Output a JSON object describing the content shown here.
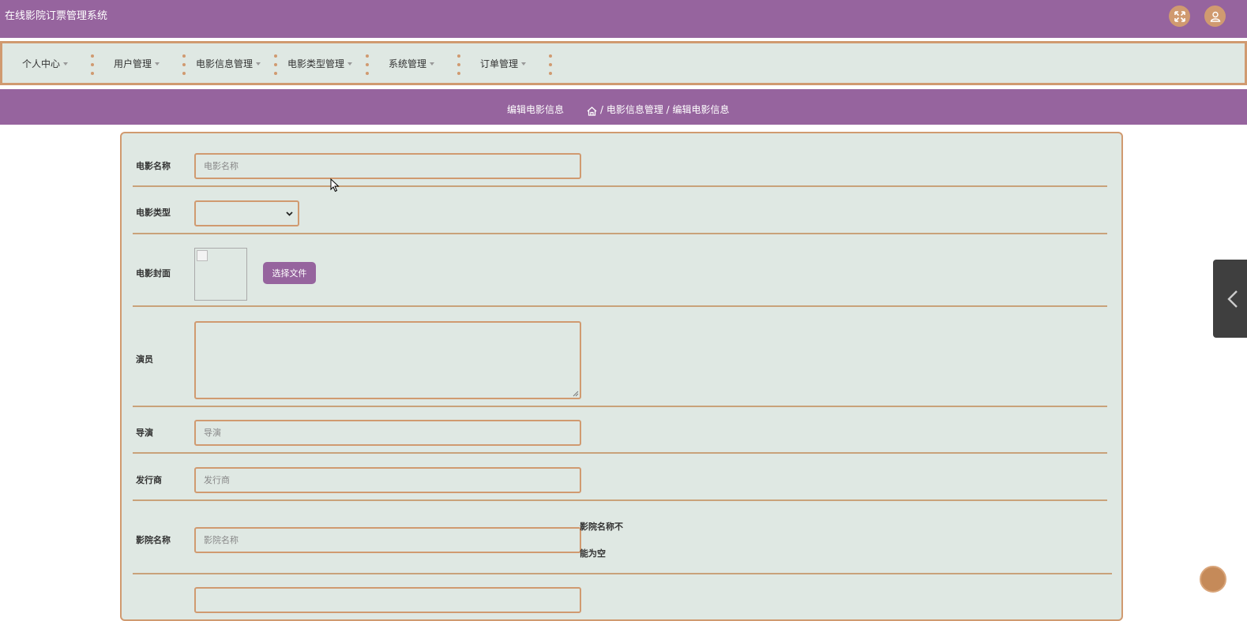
{
  "app": {
    "title": "在线影院订票管理系统"
  },
  "header": {
    "fullscreen_icon": "expand-arrows-icon",
    "user_icon": "user-icon"
  },
  "nav": {
    "items": [
      {
        "label": "个人中心"
      },
      {
        "label": "用户管理"
      },
      {
        "label": "电影信息管理"
      },
      {
        "label": "电影类型管理"
      },
      {
        "label": "系统管理"
      },
      {
        "label": "订单管理"
      }
    ]
  },
  "breadcrumb": {
    "title": "编辑电影信息",
    "home_icon": "home-icon",
    "path": "/ 电影信息管理 / 编辑电影信息"
  },
  "form": {
    "movie_name": {
      "label": "电影名称",
      "placeholder": "电影名称",
      "value": ""
    },
    "movie_type": {
      "label": "电影类型",
      "value": ""
    },
    "cover": {
      "label": "电影封面",
      "button": "选择文件"
    },
    "actors": {
      "label": "演员",
      "value": ""
    },
    "director": {
      "label": "导演",
      "placeholder": "导演",
      "value": ""
    },
    "distributor": {
      "label": "发行商",
      "placeholder": "发行商",
      "value": ""
    },
    "cinema_name": {
      "label": "影院名称",
      "placeholder": "影院名称",
      "error_line1": "影院名称不",
      "error_line2": "能为空"
    }
  },
  "colors": {
    "primary": "#96649e",
    "accent": "#d09a70",
    "panel_bg": "#dfe8e3"
  }
}
